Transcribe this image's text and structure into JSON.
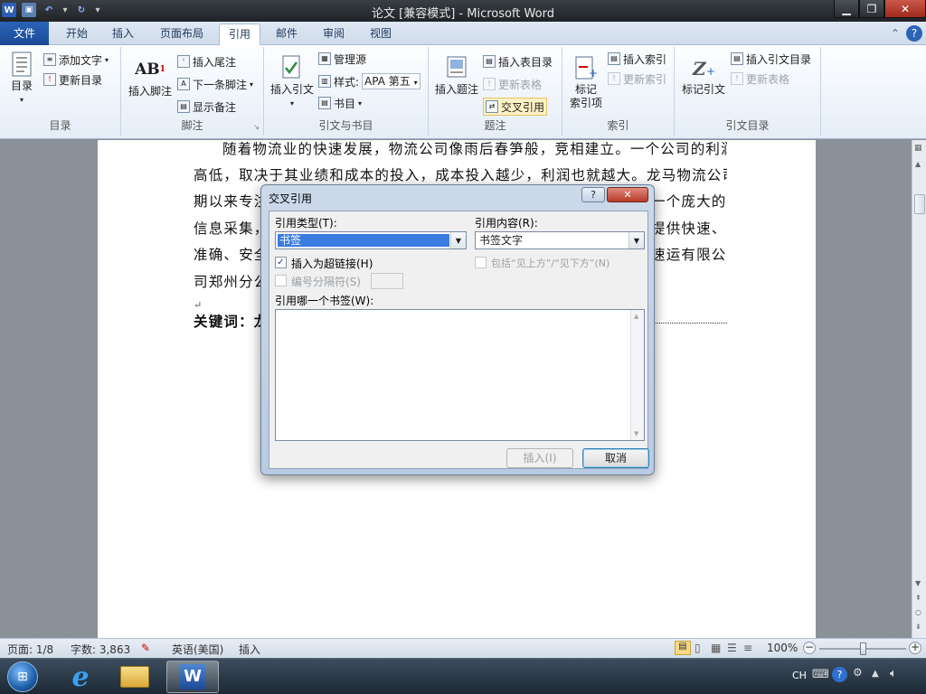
{
  "window": {
    "title": "论文 [兼容模式] - Microsoft Word",
    "min": "▁",
    "max": "❐",
    "close": "✕"
  },
  "tabs": [
    {
      "label": "文件"
    },
    {
      "label": "开始"
    },
    {
      "label": "插入"
    },
    {
      "label": "页面布局"
    },
    {
      "label": "引用"
    },
    {
      "label": "邮件"
    },
    {
      "label": "审阅"
    },
    {
      "label": "视图"
    }
  ],
  "ribbon": {
    "toc": {
      "big": "目录",
      "add_text": "添加文字",
      "update": "更新目录",
      "label": "目录"
    },
    "footnote": {
      "big": "插入脚注",
      "endnote": "插入尾注",
      "next": "下一条脚注",
      "show": "显示备注",
      "label": "脚注"
    },
    "citation": {
      "big": "插入引文",
      "manage": "管理源",
      "style_label": "样式:",
      "style_value": "APA 第五",
      "biblio": "书目",
      "label": "引文与书目"
    },
    "caption": {
      "big": "插入题注",
      "tof": "插入表目录",
      "update_table": "更新表格",
      "xref": "交叉引用",
      "label": "题注"
    },
    "index": {
      "big_line1": "标记",
      "big_line2": "索引项",
      "insert": "插入索引",
      "update": "更新索引",
      "label": "索引"
    },
    "toa": {
      "big": "标记引文",
      "insert": "插入引文目录",
      "update": "更新表格",
      "label": "引文目录"
    }
  },
  "document": {
    "lines": [
      "随着物流业的快速发展，物流公司像雨后春笋般，竞相建立。一个公司的利润的",
      "高低，取决于其业绩和成本的投入，成本投入越少，利润也就越大。龙马物流公司长",
      "期以来专注",
      "信息采集，",
      "准确、安全",
      "司郑州分公"
    ],
    "right_fragments": [
      "一个庞大的",
      "提供快速、",
      "速运有限公"
    ],
    "para_mark": "↵",
    "keyword_label": "关键词：龙"
  },
  "dialog": {
    "title": "交叉引用",
    "help": "?",
    "close": "✕",
    "ref_type_label": "引用类型(T):",
    "ref_type_value": "书签",
    "ref_content_label": "引用内容(R):",
    "ref_content_value": "书签文字",
    "hyperlink_label": "插入为超链接(H)",
    "hyperlink_checked": true,
    "include_label": "包括“见上方”/“见下方”(N)",
    "separator_label": "编号分隔符(S)",
    "which_label": "引用哪一个书签(W):",
    "insert_button": "插入(I)",
    "cancel_button": "取消"
  },
  "status": {
    "page": "页面: 1/8",
    "words": "字数: 3,863",
    "language": "英语(美国)",
    "mode": "插入",
    "zoom": "100%"
  },
  "tray": {
    "ime": "CH"
  },
  "colors": {
    "accent": "#1a4a95",
    "selection": "#3a7ce0"
  }
}
